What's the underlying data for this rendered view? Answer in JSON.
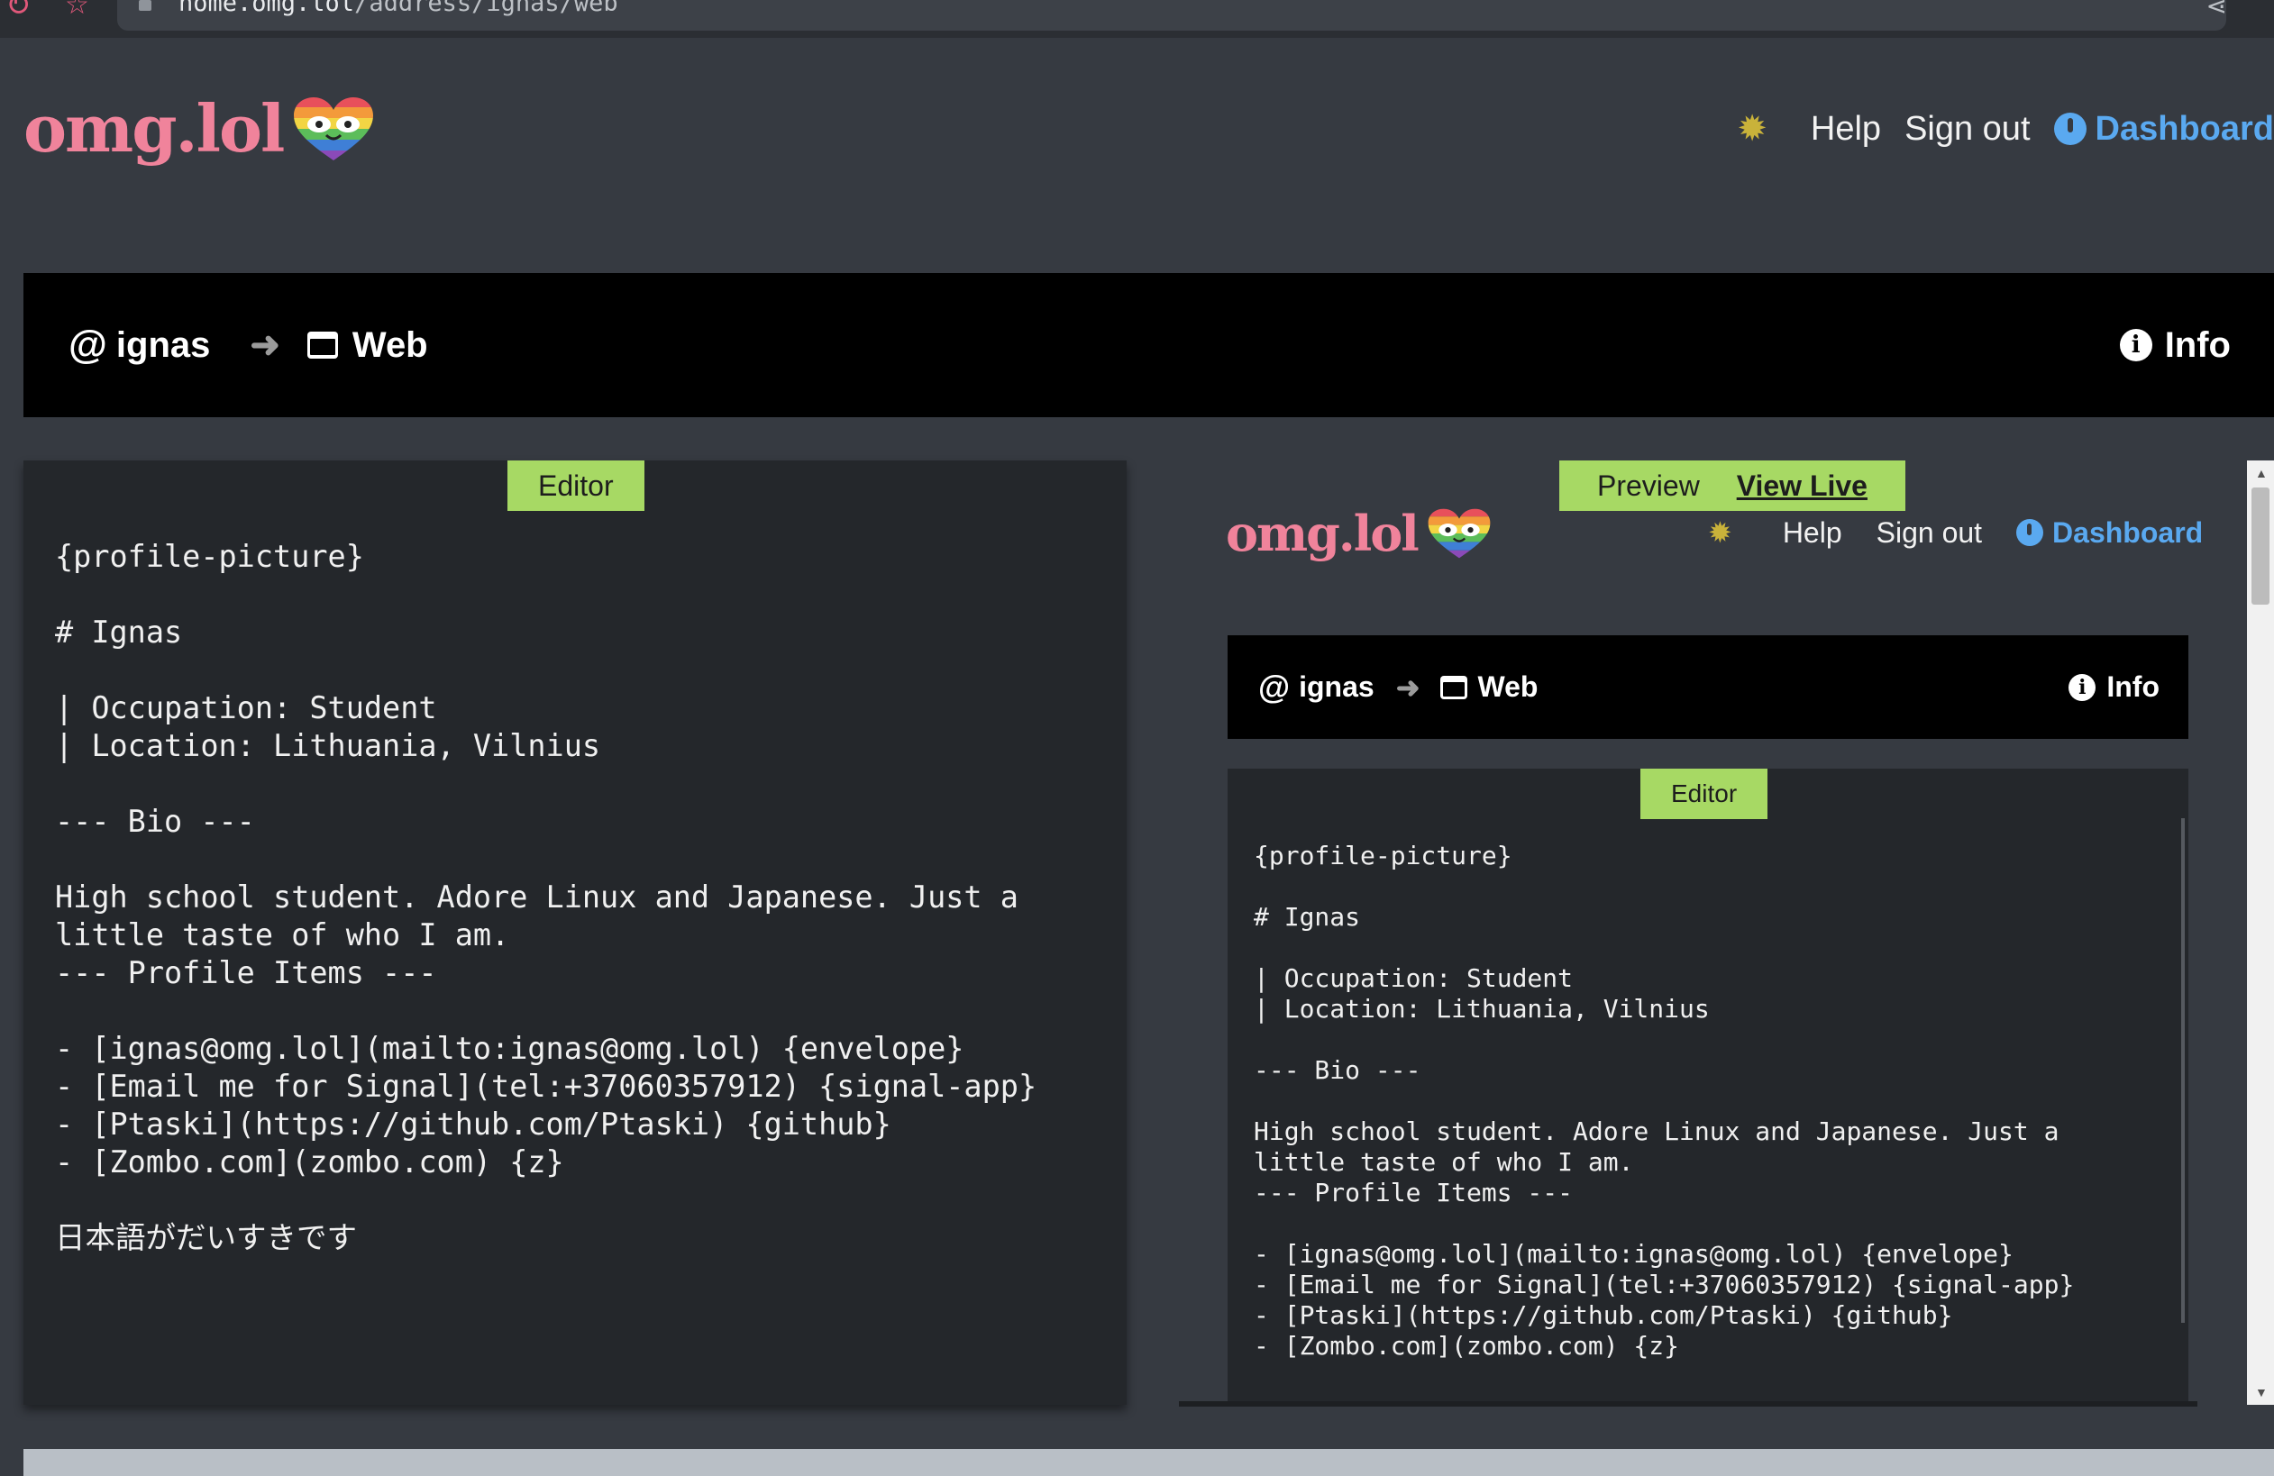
{
  "browser": {
    "url_host": "home.omg.lol",
    "url_path": "/address/ignas/web"
  },
  "header": {
    "logo_text": "omg.lol",
    "nav": {
      "help": "Help",
      "sign_out": "Sign out",
      "dashboard": "Dashboard"
    }
  },
  "breadcrumb": {
    "at_symbol": "@",
    "address": "ignas",
    "section": "Web",
    "info": "Info"
  },
  "editor": {
    "tab_label": "Editor",
    "content": "{profile-picture}\n\n# Ignas\n\n| Occupation: Student\n| Location: Lithuania, Vilnius\n\n--- Bio ---\n\nHigh school student. Adore Linux and Japanese. Just a\nlittle taste of who I am.\n--- Profile Items ---\n\n- [ignas@omg.lol](mailto:ignas@omg.lol) {envelope}\n- [Email me for Signal](tel:+37060357912) {signal-app}\n- [Ptaski](https://github.com/Ptaski) {github}\n- [Zombo.com](zombo.com) {z}\n\n日本語がだいすきです"
  },
  "preview": {
    "tab_label": "Preview",
    "view_live": "View Live",
    "logo_text": "omg.lol",
    "nav": {
      "help": "Help",
      "sign_out": "Sign out",
      "dashboard": "Dashboard"
    },
    "breadcrumb": {
      "at_symbol": "@",
      "address": "ignas",
      "section": "Web",
      "info": "Info"
    },
    "editor_tab_label": "Editor",
    "editor_content": "{profile-picture}\n\n# Ignas\n\n| Occupation: Student\n| Location: Lithuania, Vilnius\n\n--- Bio ---\n\nHigh school student. Adore Linux and Japanese. Just a\nlittle taste of who I am.\n--- Profile Items ---\n\n- [ignas@omg.lol](mailto:ignas@omg.lol) {envelope}\n- [Email me for Signal](tel:+37060357912) {signal-app}\n- [Ptaski](https://github.com/Ptaski) {github}\n- [Zombo.com](zombo.com) {z}"
  },
  "colors": {
    "background": "#363a41",
    "logo_pink": "#f0839b",
    "dashboard_blue": "#5aa9f0",
    "tag_green": "#a7d964",
    "editor_bg": "#24272b"
  },
  "icons": {
    "theme_toggle": "sun-icon",
    "dashboard": "dashboard-icon",
    "section": "window-icon",
    "info": "info-icon",
    "arrow": "arrow-right-icon"
  }
}
